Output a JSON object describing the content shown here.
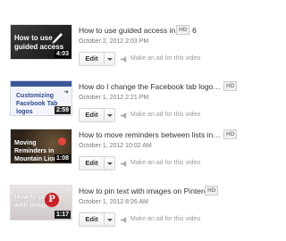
{
  "videos": [
    {
      "thumbnail_caption": "How to use guided access",
      "duration": "4:03",
      "title": "How to use guided access in iOS 6",
      "hd_badge": "HD",
      "date": "October 2, 2012 2:03 PM",
      "edit_label": "Edit",
      "ad_link": "Make an ad for this video"
    },
    {
      "thumbnail_caption": "Customizing Facebook Tab logos",
      "duration": "2:59",
      "title": "How do I change the Facebook tab logos f...",
      "hd_badge": "HD",
      "date": "October 1, 2012 2:21 PM",
      "edit_label": "Edit",
      "ad_link": "Make an ad for this video"
    },
    {
      "thumbnail_caption": "Moving Reminders in Mountain Lion",
      "duration": "1:08",
      "title": "How to move reminders between lists in M...",
      "hd_badge": "HD",
      "date": "October 1, 2012 10:02 AM",
      "edit_label": "Edit",
      "ad_link": "Make an ad for this video"
    },
    {
      "thumbnail_caption": "How to pin text with images",
      "duration": "1:17",
      "title": "How to pin text with images on Pinterest",
      "hd_badge": "HD",
      "date": "October 1, 2012 8:26 AM",
      "edit_label": "Edit",
      "ad_link": "Make an ad for this video"
    }
  ],
  "colors": {
    "facebook_blue": "#3b5998",
    "pinterest_red": "#cb2027",
    "link_gray": "#999999"
  },
  "icons": {
    "dropdown": "chevron-down-icon",
    "ad": "megaphone-icon"
  }
}
